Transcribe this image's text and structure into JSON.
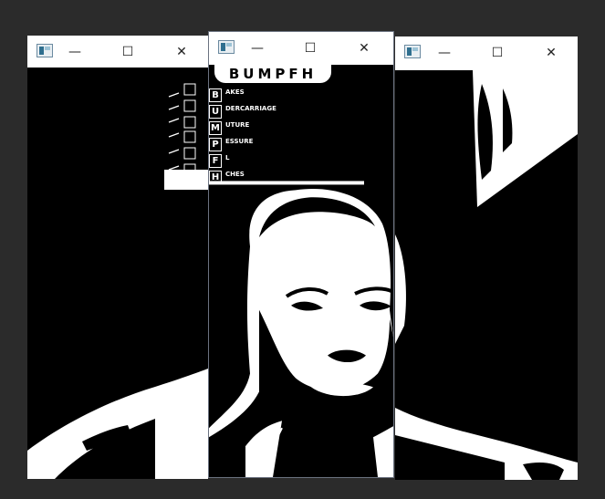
{
  "windows": [
    {
      "id": "left",
      "controls": {
        "minimize": "—",
        "maximize": "☐",
        "close": "✕"
      }
    },
    {
      "id": "center",
      "controls": {
        "minimize": "—",
        "maximize": "☐",
        "close": "✕"
      }
    },
    {
      "id": "right",
      "controls": {
        "minimize": "—",
        "maximize": "☐",
        "close": "✕"
      }
    }
  ],
  "sign": {
    "title": "BUMPFH",
    "letters": [
      "B",
      "U",
      "M",
      "P",
      "F",
      "H"
    ],
    "rows": [
      "AKES",
      "DERCARRIAGE",
      "UTURE",
      "ESSURE",
      "L",
      "CHES"
    ]
  },
  "colors": {
    "desktop": "#2b2b2b",
    "titlebar": "#ffffff",
    "image_bg": "#000000",
    "image_fg": "#ffffff"
  }
}
